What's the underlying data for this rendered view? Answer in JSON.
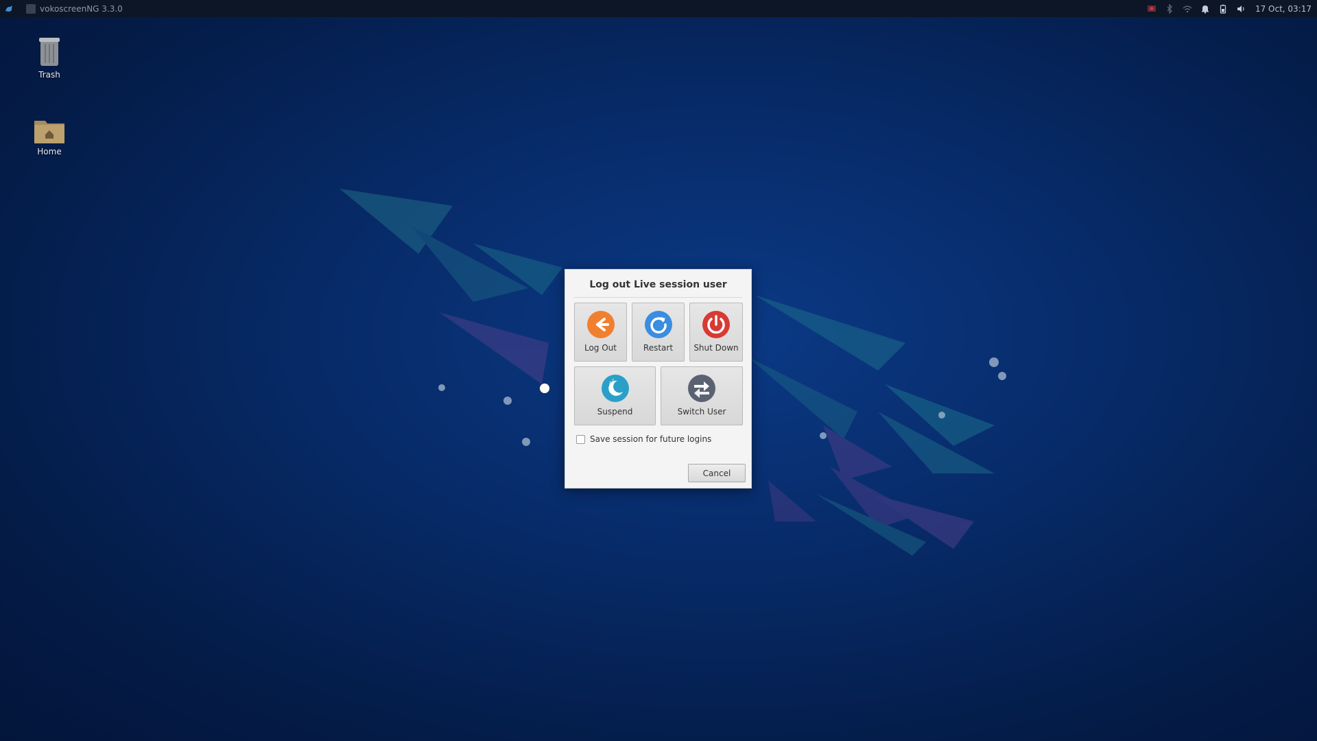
{
  "panel": {
    "app_title": "vokoscreenNG 3.3.0",
    "clock": "17 Oct, 03:17",
    "tray_icons": [
      "screen-record-icon",
      "bluetooth-icon",
      "network-icon",
      "notification-bell-icon",
      "battery-icon",
      "volume-icon"
    ]
  },
  "desktop": {
    "icons": [
      {
        "label": "Trash",
        "icon": "trash-icon"
      },
      {
        "label": "Home",
        "icon": "home-folder-icon"
      }
    ]
  },
  "dialog": {
    "title": "Log out Live session user",
    "actions": [
      {
        "label": "Log Out",
        "icon": "logout-arrow-icon",
        "color": "#f08030"
      },
      {
        "label": "Restart",
        "icon": "restart-icon",
        "color": "#3a8de0"
      },
      {
        "label": "Shut Down",
        "icon": "power-icon",
        "color": "#d83a34"
      },
      {
        "label": "Suspend",
        "icon": "suspend-moon-icon",
        "color": "#2aa0c8"
      },
      {
        "label": "Switch User",
        "icon": "switch-user-icon",
        "color": "#5a6272"
      }
    ],
    "save_session_label": "Save session for future logins",
    "save_session_checked": false,
    "cancel_label": "Cancel"
  },
  "colors": {
    "wallpaper_base": "#072a67",
    "panel_bg": "#0d1626"
  }
}
